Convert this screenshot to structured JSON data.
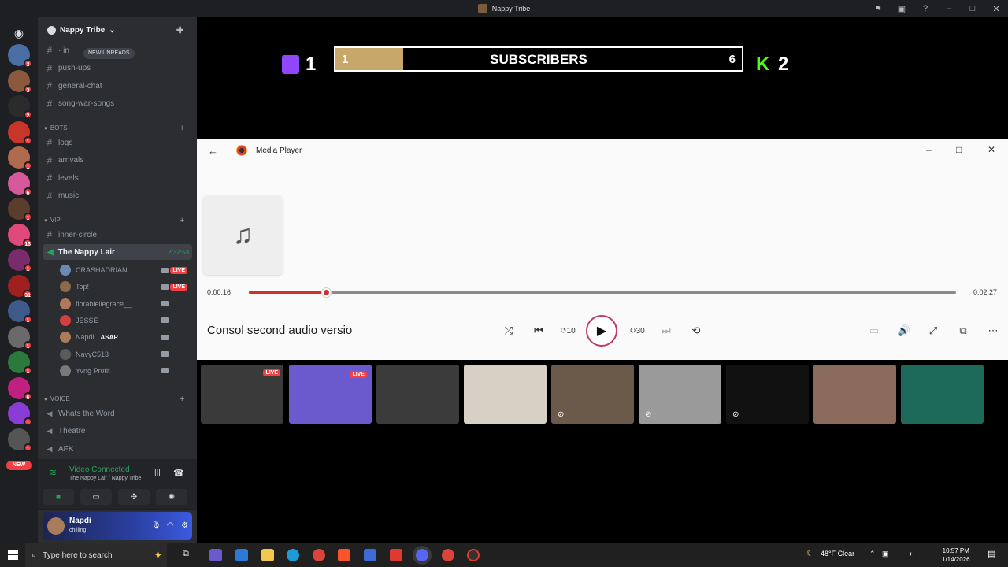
{
  "window": {
    "title": "Nappy Tribe"
  },
  "rail": {
    "servers": [
      {
        "color": "#4a6fa5",
        "badge": "2"
      },
      {
        "color": "#8b5a3c",
        "badge": "3"
      },
      {
        "color": "#2b2b2b",
        "badge": "2"
      },
      {
        "color": "#c8362b",
        "badge": "1"
      },
      {
        "color": "#b06a4d",
        "badge": "1"
      },
      {
        "color": "#d65a9a",
        "badge": "6"
      },
      {
        "color": "#5a3d2b",
        "badge": "1"
      },
      {
        "color": "#e04a7a",
        "badge": "13"
      },
      {
        "color": "#7a2b6b",
        "badge": "1"
      },
      {
        "color": "#a02020",
        "badge": "31"
      },
      {
        "color": "#3d5a8a",
        "badge": "1"
      },
      {
        "color": "#6a6a6a",
        "badge": "1"
      },
      {
        "color": "#2b7a3d",
        "badge": "1"
      },
      {
        "color": "#c02080",
        "badge": "6"
      },
      {
        "color": "#8a3dd6",
        "badge": "1"
      },
      {
        "color": "#555555",
        "badge": "1"
      }
    ],
    "new_label": "NEW"
  },
  "sidebar": {
    "guild_name": "Nappy Tribe",
    "new_unreads": "NEW UNREADS",
    "channels_top": [
      {
        "icon": "#",
        "label": "· in"
      },
      {
        "icon": "#",
        "label": "push-ups"
      },
      {
        "icon": "#",
        "label": "general-chat"
      },
      {
        "icon": "#",
        "label": "song-war-songs"
      }
    ],
    "cat_bots": "BOTS",
    "channels_bots": [
      {
        "icon": "#",
        "label": "logs"
      },
      {
        "icon": "#",
        "label": "arrivals"
      },
      {
        "icon": "#",
        "label": "levels"
      },
      {
        "icon": "#",
        "label": "music"
      }
    ],
    "cat_vip": "VIP",
    "channels_vip": [
      {
        "icon": "#",
        "label": "inner-circle"
      }
    ],
    "active_voice": {
      "label": "The Nappy Lair",
      "timer": "2:32:53"
    },
    "voice_users": [
      {
        "name": "CRASHADRIAN",
        "live": "LIVE",
        "color": "#6a8ab5"
      },
      {
        "name": "Top!",
        "live": "LIVE",
        "color": "#8a6a4a"
      },
      {
        "name": "florablellegrace__",
        "live": "",
        "color": "#b07a5a"
      },
      {
        "name": "JESSE",
        "live": "",
        "color": "#d04040"
      },
      {
        "name": "Napdi",
        "live": "",
        "color": "#a97d5b",
        "tag": "ASAP"
      },
      {
        "name": "NavyC513",
        "live": "",
        "color": "#5a5a5a"
      },
      {
        "name": "Yvng Profit",
        "live": "",
        "color": "#7a7a7a"
      }
    ],
    "cat_voice": "VOICE",
    "voice_channels": [
      {
        "label": "Whats the Word"
      },
      {
        "label": "Theatre"
      },
      {
        "label": "AFK"
      }
    ],
    "voice_panel": {
      "status": "Video Connected",
      "location": "The Nappy Lair / Nappy Tribe"
    },
    "user": {
      "name": "Napdi",
      "status": "chilling"
    }
  },
  "overlay": {
    "twitch_count": "1",
    "kick_count": "2",
    "sub_current": "1",
    "sub_label": "SUBSCRIBERS",
    "sub_goal": "6",
    "sub_fill": 0.167
  },
  "player": {
    "title": "Media Player",
    "song": "Consol second audio versio",
    "time_current": "0:00:16",
    "time_total": "0:02:27",
    "progress": 0.109
  },
  "thumbs": [
    {
      "color": "#3a3a3a",
      "live": "LIVE"
    },
    {
      "color": "#6a5acd",
      "live": "LIVE"
    },
    {
      "color": "#3b3b3b",
      "live": ""
    },
    {
      "color": "#d8d0c4",
      "live": ""
    },
    {
      "color": "#6b5a4a",
      "live": ""
    },
    {
      "color": "#9a9a9a",
      "live": ""
    },
    {
      "color": "#111111",
      "live": ""
    },
    {
      "color": "#8a6a5a",
      "live": ""
    },
    {
      "color": "#1e6a5a",
      "live": ""
    }
  ],
  "taskbar": {
    "search_placeholder": "Type here to search",
    "weather": "48°F  Clear",
    "time": "10:57 PM",
    "date": "1/14/2026"
  }
}
